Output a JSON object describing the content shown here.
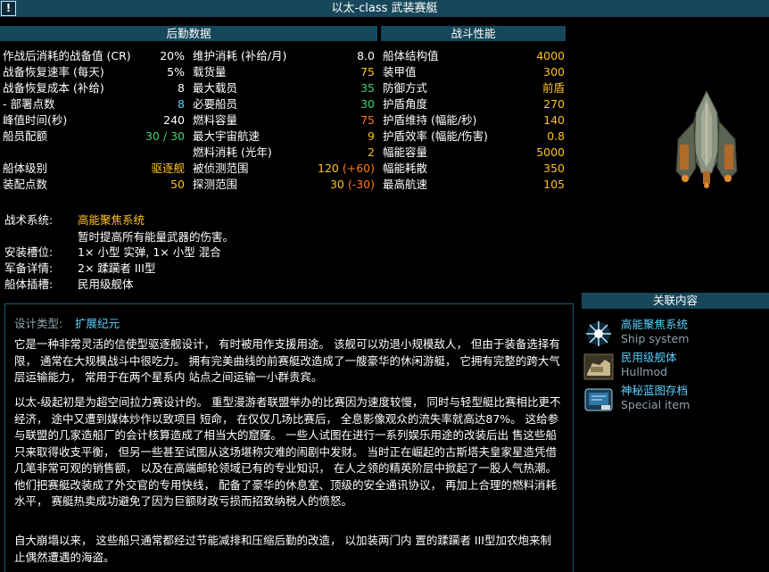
{
  "title": "以太-class 武装赛艇",
  "info_icon": "!",
  "logistics": {
    "header": "后勤数据",
    "left": [
      {
        "label": "作战后消耗的战备值 (CR)",
        "value": "20%",
        "color": "#ffffff"
      },
      {
        "label": "战备恢复速率 (每天)",
        "value": "5%",
        "color": "#ffffff"
      },
      {
        "label": "战备恢复成本 (补给)",
        "value": "8",
        "color": "#ffffff"
      },
      {
        "label": " - 部署点数",
        "value": "8",
        "color": "#5ad0ff"
      },
      {
        "label": "峰值时间(秒)",
        "value": "240",
        "color": "#ffffff"
      },
      {
        "label": "船员配额",
        "value": "30 / 30",
        "color": "#3ed670"
      },
      {
        "label": "",
        "value": "",
        "color": "#ffffff"
      },
      {
        "label": "船体级别",
        "value": "驱逐舰",
        "color": "#ffc21a"
      },
      {
        "label": "装配点数",
        "value": "50",
        "color": "#ffc21a"
      }
    ],
    "right": [
      {
        "label": "维护消耗 (补给/月)",
        "value": "8.0",
        "color": "#ffffff"
      },
      {
        "label": "载货量",
        "value": "75",
        "color": "#ffc21a"
      },
      {
        "label": "最大载员",
        "value": "35",
        "color": "#3ed670"
      },
      {
        "label": "必要船员",
        "value": "30",
        "color": "#3ed670"
      },
      {
        "label": "燃料容量",
        "value": "75",
        "color": "#ff7a1a"
      },
      {
        "label": "最大宇宙航速",
        "value": "9",
        "color": "#ffc21a"
      },
      {
        "label": " 燃料消耗 (光年)",
        "value": "2",
        "color": "#ffc21a"
      },
      {
        "label": "被侦测范围",
        "value": "120",
        "extra": " (+60)",
        "color": "#ffc21a",
        "extra_color": "#ff7a1a"
      },
      {
        "label": "探测范围",
        "value": "30",
        "extra": " (-30)",
        "color": "#ffc21a",
        "extra_color": "#ff7a1a"
      }
    ]
  },
  "combat": {
    "header": "战斗性能",
    "rows": [
      {
        "label": "船体结构值",
        "value": "4000"
      },
      {
        "label": "装甲值",
        "value": "300"
      },
      {
        "label": "防御方式",
        "value": "前盾"
      },
      {
        "label": "护盾角度",
        "value": "270"
      },
      {
        "label": "护盾维持 (幅能/秒)",
        "value": "140"
      },
      {
        "label": "护盾效率 (幅能/伤害)",
        "value": "0.8"
      },
      {
        "label": "幅能容量",
        "value": "5000"
      },
      {
        "label": "幅能耗散",
        "value": "350"
      },
      {
        "label": "最高航速",
        "value": "105"
      }
    ]
  },
  "tech": {
    "system_label": "战术系统:",
    "system_name": "高能聚焦系统",
    "system_desc": "暂时提高所有能量武器的伤害。",
    "mounts_label": "安装槽位:",
    "mounts_value": "1× 小型 实弹, 1× 小型 混合",
    "armaments_label": "军备详情:",
    "armaments_value": "2× 蹂躏者 III型",
    "hullmods_label": "船体插槽:",
    "hullmods_value": "民用级舰体"
  },
  "description": {
    "design_type_label": "设计类型:",
    "design_type_value": "扩展纪元",
    "paragraphs": [
      "它是一种非常灵活的信使型驱逐舰设计， 有时被用作支援用途。 该舰可以劝退小规模敌人， 但由于装备选择有限， 通常在大规模战斗中很吃力。 拥有完美曲线的前赛艇改造成了一艘豪华的休闲游艇， 它拥有完整的跨大气层运输能力， 常用于在两个星系内 站点之间运输一小群贵宾。",
      "以太-级起初是为超空间拉力赛设计的。 重型漫游者联盟举办的比赛因为速度较慢， 同时与轻型艇比赛相比更不经济， 途中又遭到媒体炒作以致项目 短命， 在仅仅几场比赛后， 全息影像观众的流失率就高达87%。 这给参与联盟的几家造船厂的会计核算造成了相当大的窟窿。 一些人试图在进行一系列娱乐用途的改装后出 售这些船只来取得收支平衡， 但另一些甚至试图从这场堪称灾难的闹剧中发财。 当时正在崛起的古斯塔夫皇家星造凭借几笔非常可观的销售额， 以及在高端邮轮领域已有的专业知识， 在人之领的精英阶层中掀起了一股人气热潮。 他们把赛艇改装成了外交官的专用快线， 配备了豪华的休息室、顶级的安全通讯协议， 再加上合理的燃料消耗水平， 赛艇热卖成功避免了因为巨额财政亏损而招致纳税人的愤怒。",
      "自大崩塌以来， 这些船只通常都经过节能减排和压缩后勤的改造， 以加装两门内 置的蹂躏者 III型加农炮来制止偶然遭遇的海盗。"
    ]
  },
  "related": {
    "header": "关联内容",
    "items": [
      {
        "title": "高能聚焦系统",
        "subtitle": "Ship system",
        "icon": "energy-burst-icon"
      },
      {
        "title": "民用级舰体",
        "subtitle": "Hullmod",
        "icon": "hullmod-icon"
      },
      {
        "title": "神秘蓝图存档",
        "subtitle": "Special item",
        "icon": "blueprint-icon"
      }
    ]
  }
}
